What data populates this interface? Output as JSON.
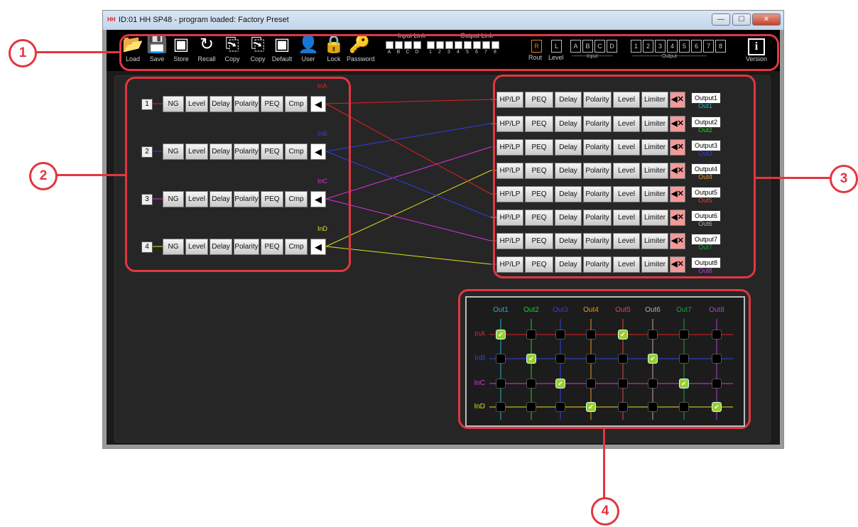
{
  "window": {
    "title": "ID:01  HH SP48  - program loaded: Factory Preset",
    "logo": "HH",
    "btn_min": "—",
    "btn_max": "☐",
    "btn_close": "✕"
  },
  "toolbar": {
    "tools": [
      {
        "label": "Load",
        "glyph": "📂"
      },
      {
        "label": "Save",
        "glyph": "💾"
      },
      {
        "label": "Store",
        "glyph": "▣"
      },
      {
        "label": "Recall",
        "glyph": "↻"
      },
      {
        "label": "Copy",
        "glyph": "⎘"
      },
      {
        "label": "Copy",
        "glyph": "⎘"
      },
      {
        "label": "Default",
        "glyph": "▣"
      },
      {
        "label": "User",
        "glyph": "👤"
      },
      {
        "label": "Lock",
        "glyph": "🔒"
      },
      {
        "label": "Password",
        "glyph": "🔑"
      }
    ],
    "input_link_title": "Input Link",
    "output_link_title": "Output Link",
    "input_link_labels": [
      "A",
      "B",
      "C",
      "D"
    ],
    "output_link_labels": [
      "1",
      "2",
      "3",
      "4",
      "5",
      "6",
      "7",
      "8"
    ],
    "rout": "R",
    "rout_label": "Rout",
    "level": "L",
    "level_label": "Level",
    "input_boxes": [
      "A",
      "B",
      "C",
      "D"
    ],
    "input_label": "---------Input---------",
    "output_boxes": [
      "1",
      "2",
      "3",
      "4",
      "5",
      "6",
      "7",
      "8"
    ],
    "output_label": "------------------Output------------------",
    "version_glyph": "i",
    "version_label": "Version"
  },
  "inputs": [
    {
      "num": "1",
      "name": "InA",
      "color": "#e02020"
    },
    {
      "num": "2",
      "name": "InB",
      "color": "#2f3fe0"
    },
    {
      "num": "3",
      "name": "InC",
      "color": "#e030e0"
    },
    {
      "num": "4",
      "name": "InD",
      "color": "#e0e020"
    }
  ],
  "input_blocks": [
    "NG",
    "Level",
    "Delay",
    "Polarity",
    "PEQ",
    "Cmp"
  ],
  "speaker_glyph": "◀",
  "output_blocks": [
    "HP/LP",
    "PEQ",
    "Delay",
    "Polarity",
    "Level",
    "Limiter"
  ],
  "mute_glyph": "◀✕",
  "outputs": [
    {
      "name": "Output1",
      "sub": "Out1",
      "color": "#1fb5c8"
    },
    {
      "name": "Output2",
      "sub": "Out2",
      "color": "#20d020"
    },
    {
      "name": "Output3",
      "sub": "Out3",
      "color": "#2f3fe0"
    },
    {
      "name": "Output4",
      "sub": "Out4",
      "color": "#e89a20"
    },
    {
      "name": "Output5",
      "sub": "Out5",
      "color": "#e04848"
    },
    {
      "name": "Output6",
      "sub": "Out6",
      "color": "#c8a8a8"
    },
    {
      "name": "Output7",
      "sub": "Out7",
      "color": "#20a040"
    },
    {
      "name": "Output8",
      "sub": "Out8",
      "color": "#b040d0"
    }
  ],
  "routing": {
    "Out1": "InA",
    "Out2": "InB",
    "Out3": "InC",
    "Out4": "InD",
    "Out5": "InA",
    "Out6": "InB",
    "Out7": "InC",
    "Out8": "InD"
  },
  "matrix": {
    "cols": [
      "Out1",
      "Out2",
      "Out3",
      "Out4",
      "Out5",
      "Out6",
      "Out7",
      "Out8"
    ],
    "rows": [
      "InA",
      "InB",
      "InC",
      "InD"
    ],
    "checked": [
      [
        1,
        0,
        0,
        0,
        1,
        0,
        0,
        0
      ],
      [
        0,
        1,
        0,
        0,
        0,
        1,
        0,
        0
      ],
      [
        0,
        0,
        1,
        0,
        0,
        0,
        1,
        0
      ],
      [
        0,
        0,
        0,
        1,
        0,
        0,
        0,
        1
      ]
    ],
    "check_glyph": "✔"
  },
  "callouts": [
    "1",
    "2",
    "3",
    "4"
  ]
}
